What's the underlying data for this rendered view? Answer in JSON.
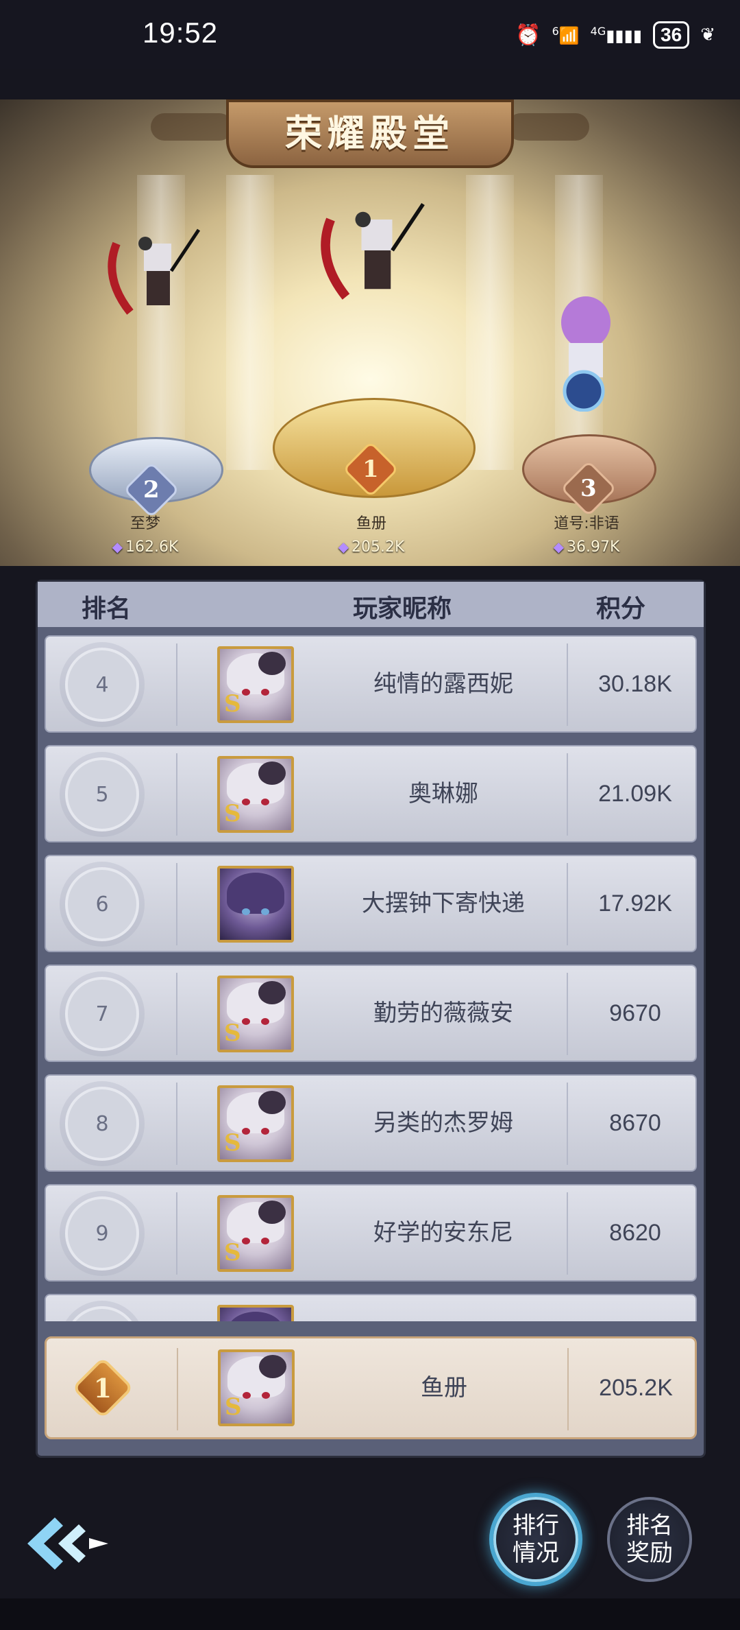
{
  "status_bar": {
    "time": "19:52",
    "battery": "36",
    "signal_label": "4G",
    "wifi_label": "6"
  },
  "header": {
    "title": "荣耀殿堂"
  },
  "podium": [
    {
      "rank": "2",
      "name": "至梦",
      "score": "162.6K"
    },
    {
      "rank": "1",
      "name": "鱼册",
      "score": "205.2K"
    },
    {
      "rank": "3",
      "name": "道号:非语",
      "score": "36.97K"
    }
  ],
  "table": {
    "headers": {
      "rank": "排名",
      "name": "玩家昵称",
      "score": "积分"
    },
    "rows": [
      {
        "rank": "4",
        "name": "纯情的露西妮",
        "score": "30.18K"
      },
      {
        "rank": "5",
        "name": "奥琳娜",
        "score": "21.09K"
      },
      {
        "rank": "6",
        "name": "大摆钟下寄快递",
        "score": "17.92K"
      },
      {
        "rank": "7",
        "name": "勤劳的薇薇安",
        "score": "9670"
      },
      {
        "rank": "8",
        "name": "另类的杰罗姆",
        "score": "8670"
      },
      {
        "rank": "9",
        "name": "好学的安东尼",
        "score": "8620"
      }
    ]
  },
  "my_row": {
    "rank": "1",
    "name": "鱼册",
    "score": "205.2K"
  },
  "buttons": {
    "ranking_status": "排行\n情况",
    "rank_reward": "排名\n奖励"
  },
  "colors": {
    "gold": "#c99b3e",
    "panel": "#5a6078",
    "header": "#aeb3c7"
  },
  "icons": [
    "alarm-icon",
    "wifi-icon",
    "signal-icon",
    "battery-icon",
    "leaf-icon",
    "gem-icon",
    "back-arrow-icon"
  ]
}
